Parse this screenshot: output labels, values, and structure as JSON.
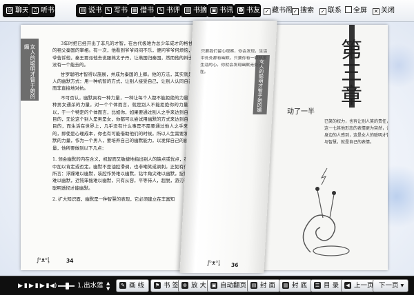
{
  "top_toolbar": {
    "buttons": [
      {
        "label": "聊天",
        "icon": "chat-icon"
      },
      {
        "label": "听书",
        "icon": "headphone-icon"
      },
      {
        "label": "说书",
        "icon": "speak-icon"
      },
      {
        "label": "写书",
        "icon": "pen-icon"
      },
      {
        "label": "借书",
        "icon": "borrow-book-icon"
      },
      {
        "label": "书评",
        "icon": "review-icon"
      },
      {
        "label": "书摘",
        "icon": "excerpt-icon"
      },
      {
        "label": "书讯",
        "icon": "news-icon"
      },
      {
        "label": "书友",
        "icon": "friends-icon"
      }
    ],
    "toggles": [
      {
        "label": "藏书阁",
        "icon": "library-checkbox-icon"
      },
      {
        "label": "搜索",
        "icon": "search-checkbox-icon"
      },
      {
        "label": "联系",
        "icon": "contact-checkbox-icon"
      },
      {
        "label": "全屏",
        "icon": "fullscreen-checkbox-icon"
      },
      {
        "label": "关闭",
        "icon": "close-icon"
      }
    ]
  },
  "book": {
    "left_page": {
      "tab_text": "女人的聪明才智于她的媚",
      "paragraphs": [
        "3年时把已经开出了非凡的才智，在古代极难为总少年成才的格甘罗的祖父秦国的宰相。有一次，他看到爷爷闷闷不乐，便问爷爷何烦恼，爷爷告诉他，秦王要派他去说服燕太子丹，让燕国归秦国，然而他的辩士都没有一个能去的。",
        "甘罗聪明才智得以施展，并成为秦国的上卿。他的方法，其实就是女人的幽默方式：用一种机智的方式，让别人接受自己，让别人认同自己，而非直接地对抗。",
        "不可否认，幽默具有一种力量，一种让每个人都不能拒绝的力量，一种男女通杀的力量，对一个个体而言，就是别人不能拒绝你的力量。所以，于一个特定的个体而言，比如你，如果要通过别人之手来达到自己的目的，无论这个别人是男是女，你都可以尝试用幽默的方式来达到自己的目的，而生活在世界上，几乎没有什么事是不需要通过他人之手来实现的，即使是心理成本，你也有可能借助他们的时候。所以人生需要发挥幽默的力量，作为一个男人，要培养自己的幽默能力，以发挥自己的幽默力量，他所要做到以下几点："
      ],
      "list_items": [
        "1. 领会幽默的内在含义，机智而又敏捷地指出别人的缺点或优点，在微笑中加以肯定或否定。幽默不是油腔滑调，也非嘲笑或讽刺。正如有位名人所言：浮躁难以幽默，装腔作势难以幽默，钻牛角尖难以幽默，捉襟见肘难以幽默，迟钝笨拙难以幽默，只有从容，平等待人，超脱，游刃有余，聪明透彻才能幽默。",
        "2. 扩大知识面，幽默是一种智慧的表现，它必须建立在丰富知"
      ],
      "page_number": "34"
    },
    "curl_page": {
      "tab_text": "女人的聪明才智于她的媚",
      "text": "只要我们留心观察，你会发现，生活中处处都有幽默。只要你有一颗热爱生活的心，你就会发现幽默无处不在。",
      "page_number": "36"
    },
    "right_page": {
      "chapter_title": "第三章",
      "chapter_subtitle": "动了一半",
      "text": "已笑的权力，也有让别人笑的责任，这一七其他形态的表情更为突然，让身边的人感到，这是女人的聪明才智与智慧，就是自己的表情。"
    }
  },
  "bottom_toolbar": {
    "media_controls": "▶▮▶▮▶▮",
    "volume_icon": "speaker-icon",
    "volume_level": 0.55,
    "song": "1.出水莲",
    "buttons": [
      {
        "label": "画 线",
        "icon": "draw-line-icon"
      },
      {
        "label": "书 签",
        "icon": "bookmark-icon"
      },
      {
        "label": "放 大",
        "icon": "zoom-in-icon"
      },
      {
        "label": "自动翻页",
        "icon": "auto-flip-icon"
      },
      {
        "label": "封 面",
        "icon": "cover-icon"
      },
      {
        "label": "封 底",
        "icon": "back-cover-icon"
      },
      {
        "label": "目 录",
        "icon": "contents-icon"
      },
      {
        "label": "上一页",
        "icon": "prev-page-icon"
      },
      {
        "label": "下一页",
        "icon": "next-page-icon"
      }
    ]
  }
}
